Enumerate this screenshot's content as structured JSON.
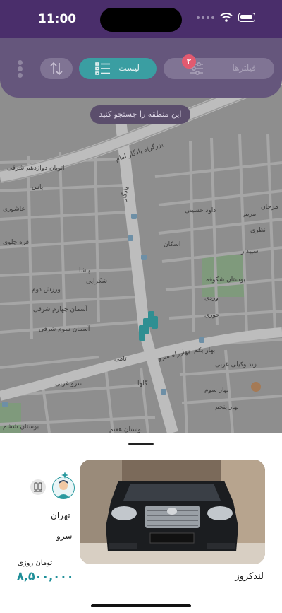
{
  "status_bar": {
    "time": "11:00"
  },
  "toolbar": {
    "filters_label": "فیلترها",
    "filters_badge": "۲",
    "list_label": "لیست",
    "sort_icon": "sort-arrows-icon",
    "more_icon": "more-vertical-icon"
  },
  "map": {
    "search_area_label": "این منطقه را جستجو کنید",
    "street_labels": [
      "بزرگراه یادگار امام",
      "اتوبان دوازدهم شرقی",
      "ستارخان",
      "داود حسینی",
      "مرجان",
      "مریم",
      "نظری",
      "سپیدار",
      "پاس",
      "عاشوری",
      "قره چلوی",
      "پاشا",
      "شکرایی",
      "ورزش دوم",
      "آسمان چهارم شرقی",
      "آسمان سوم شرقی",
      "بوستان شکوفه",
      "وردی",
      "حوری",
      "چهارراه سرو",
      "تامی",
      "سرو غربی",
      "گلها",
      "بوستان هفتم",
      "بوستان ششم",
      "بهار بکم",
      "زند وکیلی غربی",
      "بهار سوم",
      "بهار پنجم",
      "بوستان",
      "اسکان",
      "یادگار"
    ]
  },
  "car": {
    "name": "لندکروز",
    "city": "تهران",
    "area": "سرو",
    "price_unit": "تومان روزی",
    "price": "۸,۵۰۰,۰۰۰"
  },
  "colors": {
    "header": "#65567c",
    "status_bar": "#4a2e6b",
    "accent": "#3a9ea2",
    "badge": "#e25a70",
    "price": "#1f8f99"
  }
}
